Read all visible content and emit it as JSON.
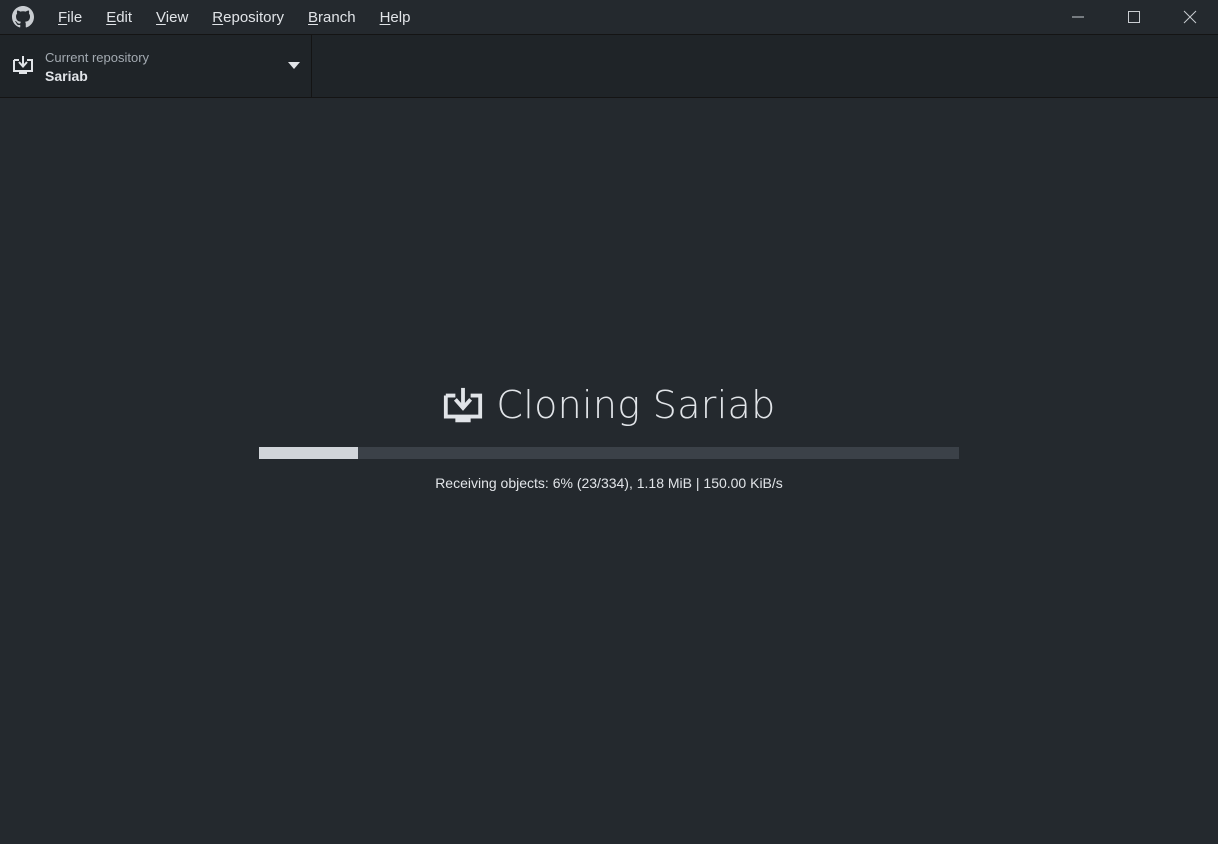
{
  "menu": {
    "items": [
      {
        "label": "File",
        "accel": "F",
        "rest": "ile"
      },
      {
        "label": "Edit",
        "accel": "E",
        "rest": "dit"
      },
      {
        "label": "View",
        "accel": "V",
        "rest": "iew"
      },
      {
        "label": "Repository",
        "accel": "R",
        "rest": "epository"
      },
      {
        "label": "Branch",
        "accel": "B",
        "rest": "ranch"
      },
      {
        "label": "Help",
        "accel": "H",
        "rest": "elp"
      }
    ]
  },
  "toolbar": {
    "repo_caption": "Current repository",
    "repo_name": "Sariab"
  },
  "clone": {
    "title": "Cloning Sariab",
    "progress_fraction": 0.142,
    "status": "Receiving objects: 6% (23/334), 1.18 MiB | 150.00 KiB/s"
  },
  "icons": {
    "app": "github-octocat-icon",
    "repo": "clone-download-icon",
    "caret": "caret-down-icon",
    "minimize": "minimize-icon",
    "maximize": "maximize-icon",
    "close": "close-icon"
  },
  "colors": {
    "background": "#24292e",
    "toolbar": "#1f2428",
    "progress_track": "#3b4148",
    "progress_fill": "#d1d5da"
  }
}
